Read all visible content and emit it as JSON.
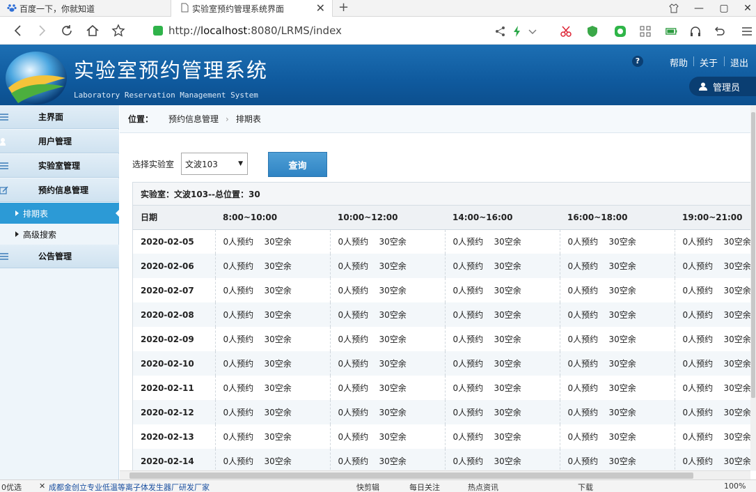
{
  "browser": {
    "tabs": [
      {
        "title": "百度一下，你就知道",
        "active": false,
        "icon": "baidu-paw-icon"
      },
      {
        "title": "实验室预约管理系统界面",
        "active": true,
        "icon": "page-icon"
      }
    ],
    "url_prefix": "http://",
    "url_host": "localhost",
    "url_rest": ":8080/LRMS/index"
  },
  "header": {
    "title": "实验室预约管理系统",
    "subtitle": "Laboratory Reservation Management System",
    "help_icon": "?",
    "links": [
      "帮助",
      "关于",
      "退出"
    ],
    "user": "管理员"
  },
  "sidebar": {
    "items": [
      {
        "label": "主界面",
        "type": "group"
      },
      {
        "label": "用户管理",
        "type": "group"
      },
      {
        "label": "实验室管理",
        "type": "group"
      },
      {
        "label": "预约信息管理",
        "type": "group"
      },
      {
        "label": "排期表",
        "type": "sub",
        "active": true
      },
      {
        "label": "高级搜索",
        "type": "sub",
        "active": false
      },
      {
        "label": "公告管理",
        "type": "group"
      }
    ]
  },
  "breadcrumb": {
    "label": "位置：",
    "items": [
      "预约信息管理",
      "排期表"
    ]
  },
  "filter": {
    "label": "选择实验室",
    "selected": "文波103",
    "button": "查询"
  },
  "schedule": {
    "summary": "实验室：文波103--总位置：30",
    "headers": [
      "日期",
      "8:00~10:00",
      "10:00~12:00",
      "14:00~16:00",
      "16:00~18:00",
      "19:00~21:00"
    ],
    "cell_reserved": "0人预约",
    "cell_free": "30空余",
    "dates": [
      "2020-02-05",
      "2020-02-06",
      "2020-02-07",
      "2020-02-08",
      "2020-02-09",
      "2020-02-10",
      "2020-02-11",
      "2020-02-12",
      "2020-02-13",
      "2020-02-14"
    ]
  },
  "statusbar": {
    "left": "0优选",
    "ad": "成都金创立专业低温等离子体发生器厂研发厂家",
    "items": [
      "快剪辑",
      "每日关注",
      "热点资讯",
      "下载",
      "100%"
    ]
  },
  "colors": {
    "header_blue": "#0f5a9e",
    "active_menu": "#2c9ad6",
    "query_button": "#2f84c4"
  }
}
